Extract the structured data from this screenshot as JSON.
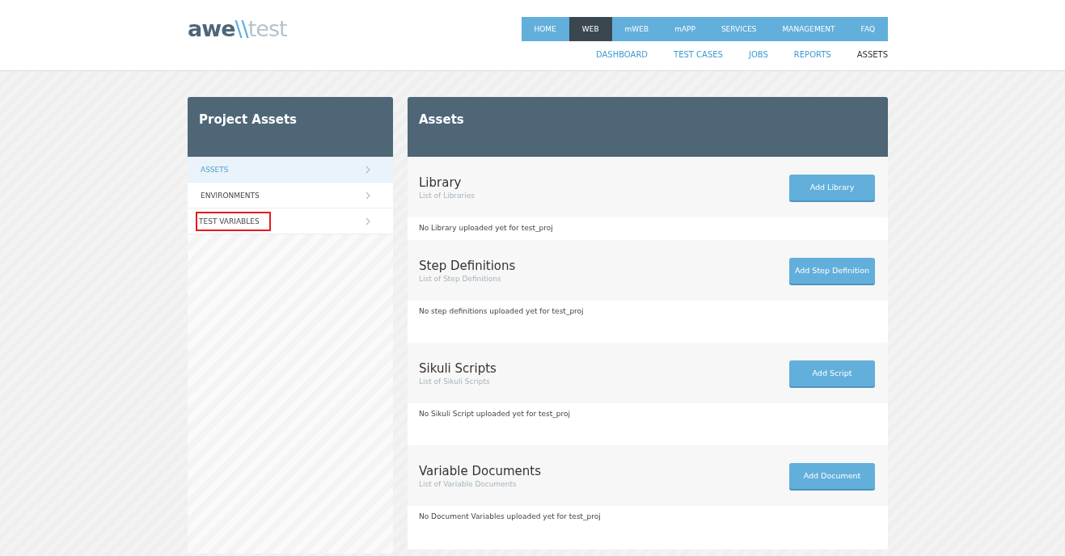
{
  "logo": {
    "strong": "awe",
    "slashes": "\\\\",
    "light": "test"
  },
  "main_nav": [
    {
      "label": "HOME",
      "selected": false
    },
    {
      "label": "WEB",
      "selected": true
    },
    {
      "label": "mWEB",
      "selected": false
    },
    {
      "label": "mAPP",
      "selected": false
    },
    {
      "label": "SERVICES",
      "selected": false
    },
    {
      "label": "MANAGEMENT",
      "selected": false
    },
    {
      "label": "FAQ",
      "selected": false
    }
  ],
  "sub_nav": [
    {
      "label": "DASHBOARD",
      "selected": false
    },
    {
      "label": "TEST CASES",
      "selected": false
    },
    {
      "label": "JOBS",
      "selected": false
    },
    {
      "label": "REPORTS",
      "selected": false
    },
    {
      "label": "ASSETS",
      "selected": true
    }
  ],
  "sidebar": {
    "title": "Project Assets",
    "items": [
      {
        "label": "ASSETS",
        "selected": true,
        "highlighted": false
      },
      {
        "label": "ENVIRONMENTS",
        "selected": false,
        "highlighted": false
      },
      {
        "label": "TEST VARIABLES",
        "selected": false,
        "highlighted": true
      }
    ]
  },
  "main": {
    "title": "Assets",
    "sections": [
      {
        "title": "Library",
        "subtitle": "List of Libraries",
        "button": "Add Library",
        "message": "No Library uploaded yet for test_proj"
      },
      {
        "title": "Step Definitions",
        "subtitle": "List of Step Definitions",
        "button": "Add Step Definition",
        "message": "No step definitions uploaded yet for test_proj"
      },
      {
        "title": "Sikuli Scripts",
        "subtitle": "List of Sikuli Scripts",
        "button": "Add Script",
        "message": "No Sikuli Script uploaded yet for test_proj"
      },
      {
        "title": "Variable Documents",
        "subtitle": "List of Variable Documents",
        "button": "Add Document",
        "message": "No Document Variables uploaded yet for test_proj"
      }
    ]
  }
}
